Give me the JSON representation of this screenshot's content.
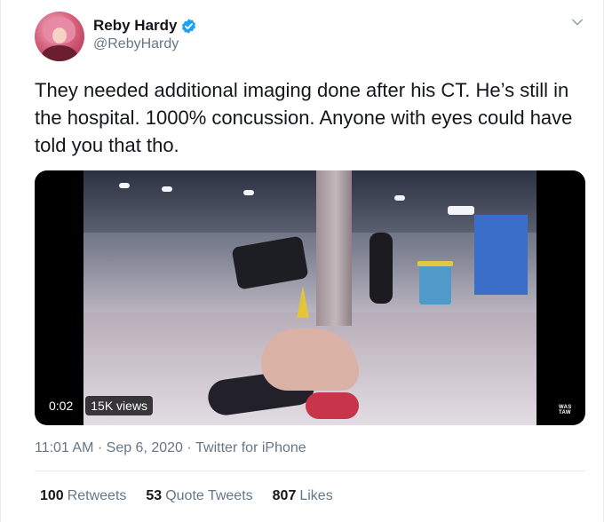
{
  "user": {
    "display_name": "Reby Hardy",
    "handle": "@RebyHardy",
    "verified_icon": "verified-badge-icon",
    "menu_icon": "chevron-down-icon"
  },
  "tweet": {
    "text": "They needed additional imaging done after his CT. He’s still in the hospital. 1000% concussion. Anyone with eyes could have told you that tho."
  },
  "media": {
    "timestamp": "0:02",
    "views": "15K views",
    "watermark": "WAS TAW"
  },
  "meta": {
    "time": "11:01 AM",
    "separator": " · ",
    "date": "Sep 6, 2020",
    "source": "Twitter for iPhone"
  },
  "stats": {
    "retweets_count": "100",
    "retweets_label": "Retweets",
    "quotes_count": "53",
    "quotes_label": "Quote Tweets",
    "likes_count": "807",
    "likes_label": "Likes"
  },
  "colors": {
    "verified": "#1da1f2",
    "secondary_text": "#657786",
    "primary_text": "#14171a",
    "divider": "#e6ecf0"
  }
}
